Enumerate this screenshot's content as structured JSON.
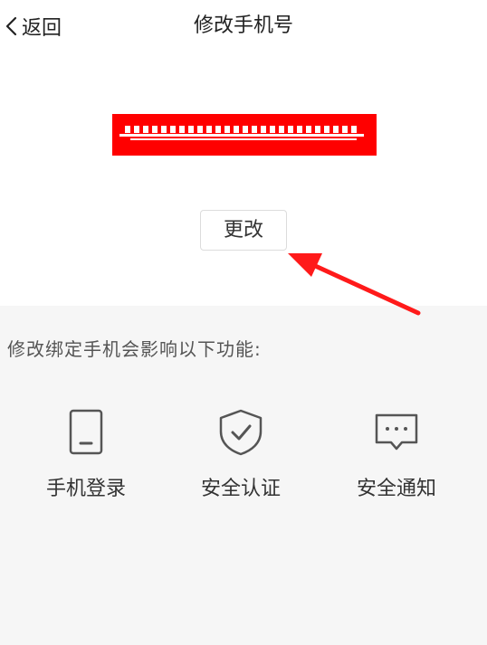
{
  "header": {
    "back_label": "返回",
    "title": "修改手机号"
  },
  "phone": {
    "number": "",
    "redacted": true,
    "redaction_color": "#ff0000"
  },
  "change_button": {
    "label": "更改"
  },
  "annotation": {
    "arrow_color": "#ff1a1a"
  },
  "affects": {
    "label": "修改绑定手机会影响以下功能:",
    "features": [
      {
        "label": "手机登录",
        "icon": "phone-icon"
      },
      {
        "label": "安全认证",
        "icon": "shield-check-icon"
      },
      {
        "label": "安全通知",
        "icon": "message-icon"
      }
    ]
  }
}
